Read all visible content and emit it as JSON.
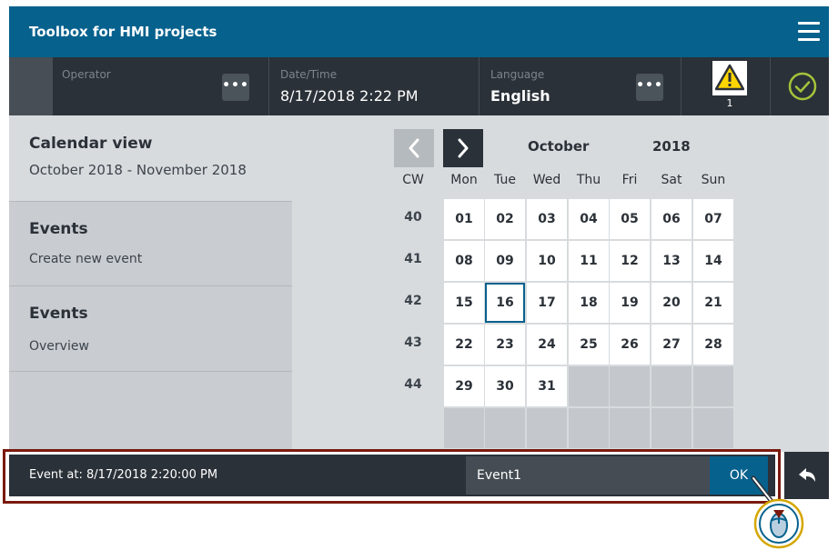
{
  "app": {
    "title": "Toolbox for HMI projects"
  },
  "status": {
    "operator_label": "Operator",
    "datetime_label": "Date/Time",
    "datetime_value": "8/17/2018 2:22 PM",
    "language_label": "Language",
    "language_value": "English",
    "dots": "•••",
    "alarm_count": "1"
  },
  "left": {
    "calendar_title": "Calendar view",
    "calendar_range": "October 2018 - November 2018",
    "tiles": [
      {
        "title": "Events",
        "sub": "Create new event"
      },
      {
        "title": "Events",
        "sub": "Overview"
      }
    ]
  },
  "calendar": {
    "month": "October",
    "year": "2018",
    "cw_header": "CW",
    "weekdays": [
      "Mon",
      "Tue",
      "Wed",
      "Thu",
      "Fri",
      "Sat",
      "Sun"
    ],
    "weeks": [
      {
        "cw": "40",
        "days": [
          "01",
          "02",
          "03",
          "04",
          "05",
          "06",
          "07"
        ]
      },
      {
        "cw": "41",
        "days": [
          "08",
          "09",
          "10",
          "11",
          "12",
          "13",
          "14"
        ]
      },
      {
        "cw": "42",
        "days": [
          "15",
          "16",
          "17",
          "18",
          "19",
          "20",
          "21"
        ]
      },
      {
        "cw": "43",
        "days": [
          "22",
          "23",
          "24",
          "25",
          "26",
          "27",
          "28"
        ]
      },
      {
        "cw": "44",
        "days": [
          "29",
          "30",
          "31",
          "",
          "",
          "",
          ""
        ]
      },
      {
        "cw": "",
        "days": [
          "",
          "",
          "",
          "",
          "",
          "",
          ""
        ]
      }
    ],
    "selected_day": "16"
  },
  "eventbar": {
    "event_at": "Event at: 8/17/2018 2:20:00 PM",
    "event_name": "Event1",
    "ok_label": "OK"
  },
  "colors": {
    "accent": "#06618d",
    "bar": "#2b3138",
    "highlight_frame": "#7a1a0e",
    "ok_check": "#a5c33b",
    "warning": "#ffd500"
  }
}
